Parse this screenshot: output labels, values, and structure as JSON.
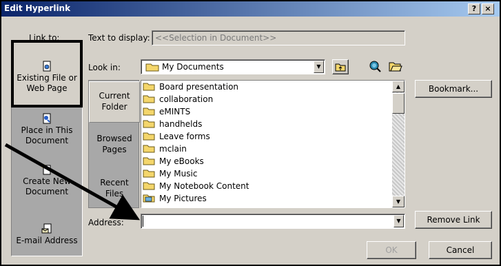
{
  "dialog": {
    "title": "Edit Hyperlink",
    "help_glyph": "?",
    "close_glyph": "×"
  },
  "link_to": {
    "label": "Link to:",
    "places": [
      {
        "label_line1": "Existing File or",
        "label_line2": "Web Page",
        "icon": "document-globe-icon",
        "selected": true
      },
      {
        "label_line1": "Place in This",
        "label_line2": "Document",
        "icon": "document-place-icon",
        "selected": false
      },
      {
        "label_line1": "Create New",
        "label_line2": "Document",
        "icon": "new-document-icon",
        "selected": false
      },
      {
        "label_line1": "E-mail Address",
        "label_line2": "",
        "icon": "email-icon",
        "selected": false
      }
    ]
  },
  "text_to_display": {
    "label": "Text to display:",
    "value": "<<Selection in Document>>"
  },
  "look_in": {
    "label": "Look in:",
    "value": "My Documents"
  },
  "browse_places": [
    {
      "line1": "Current",
      "line2": "Folder",
      "active": true
    },
    {
      "line1": "Browsed",
      "line2": "Pages",
      "active": false
    },
    {
      "line1": "Recent",
      "line2": "Files",
      "active": false
    }
  ],
  "files": [
    {
      "name": "Board presentation",
      "icon": "folder-icon"
    },
    {
      "name": "collaboration",
      "icon": "folder-icon"
    },
    {
      "name": "eMINTS",
      "icon": "folder-icon"
    },
    {
      "name": "handhelds",
      "icon": "folder-icon"
    },
    {
      "name": "Leave forms",
      "icon": "folder-icon"
    },
    {
      "name": "mclain",
      "icon": "folder-icon"
    },
    {
      "name": "My eBooks",
      "icon": "folder-icon"
    },
    {
      "name": "My Music",
      "icon": "folder-icon"
    },
    {
      "name": "My Notebook Content",
      "icon": "folder-icon"
    },
    {
      "name": "My Pictures",
      "icon": "pictures-folder-icon"
    }
  ],
  "buttons": {
    "bookmark": "Bookmark...",
    "remove_link": "Remove Link",
    "ok": "OK",
    "cancel": "Cancel"
  },
  "address": {
    "label": "Address:",
    "value": ""
  },
  "colors": {
    "title_start": "#0a246a",
    "title_end": "#a6caf0",
    "dialog_face": "#d4d0c8",
    "places_bar": "#a8a8a8",
    "folder_yellow": "#f4d66b",
    "arrow": "#000000"
  }
}
